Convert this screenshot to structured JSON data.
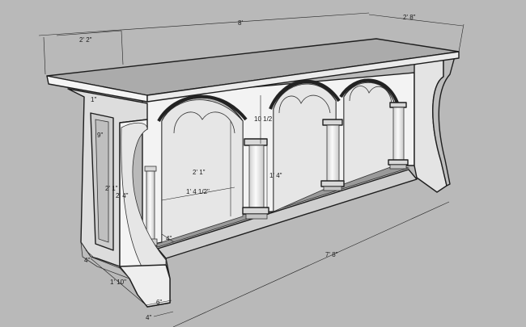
{
  "model": {
    "background_color": "#b9b9b9",
    "surface_light": "#f2f2f2",
    "surface_mid": "#dcdcdc",
    "surface_dark": "#9c9c9c",
    "edge_color": "#1e1e1e"
  },
  "dimensions": {
    "length_top": "8'",
    "depth_top": "2' 8\"",
    "end_panel_width": "2' 2\"",
    "arch_rise": "10 1/2",
    "arch_opening_height": "2' 1\"",
    "arch_opening_width": "1' 4 1/2\"",
    "column_height": "1' 4\"",
    "end_inset": "9\"",
    "end_height_a": "2' 1\"",
    "end_height_b": "2' 4\"",
    "base_length": "7' 8\"",
    "foot_depth": "1' 10\"",
    "foot_offset": "4\"",
    "foot_height": "6\"",
    "foot_inset": "4\"",
    "shelf_gap": "4\"",
    "header_depth": "1\""
  }
}
